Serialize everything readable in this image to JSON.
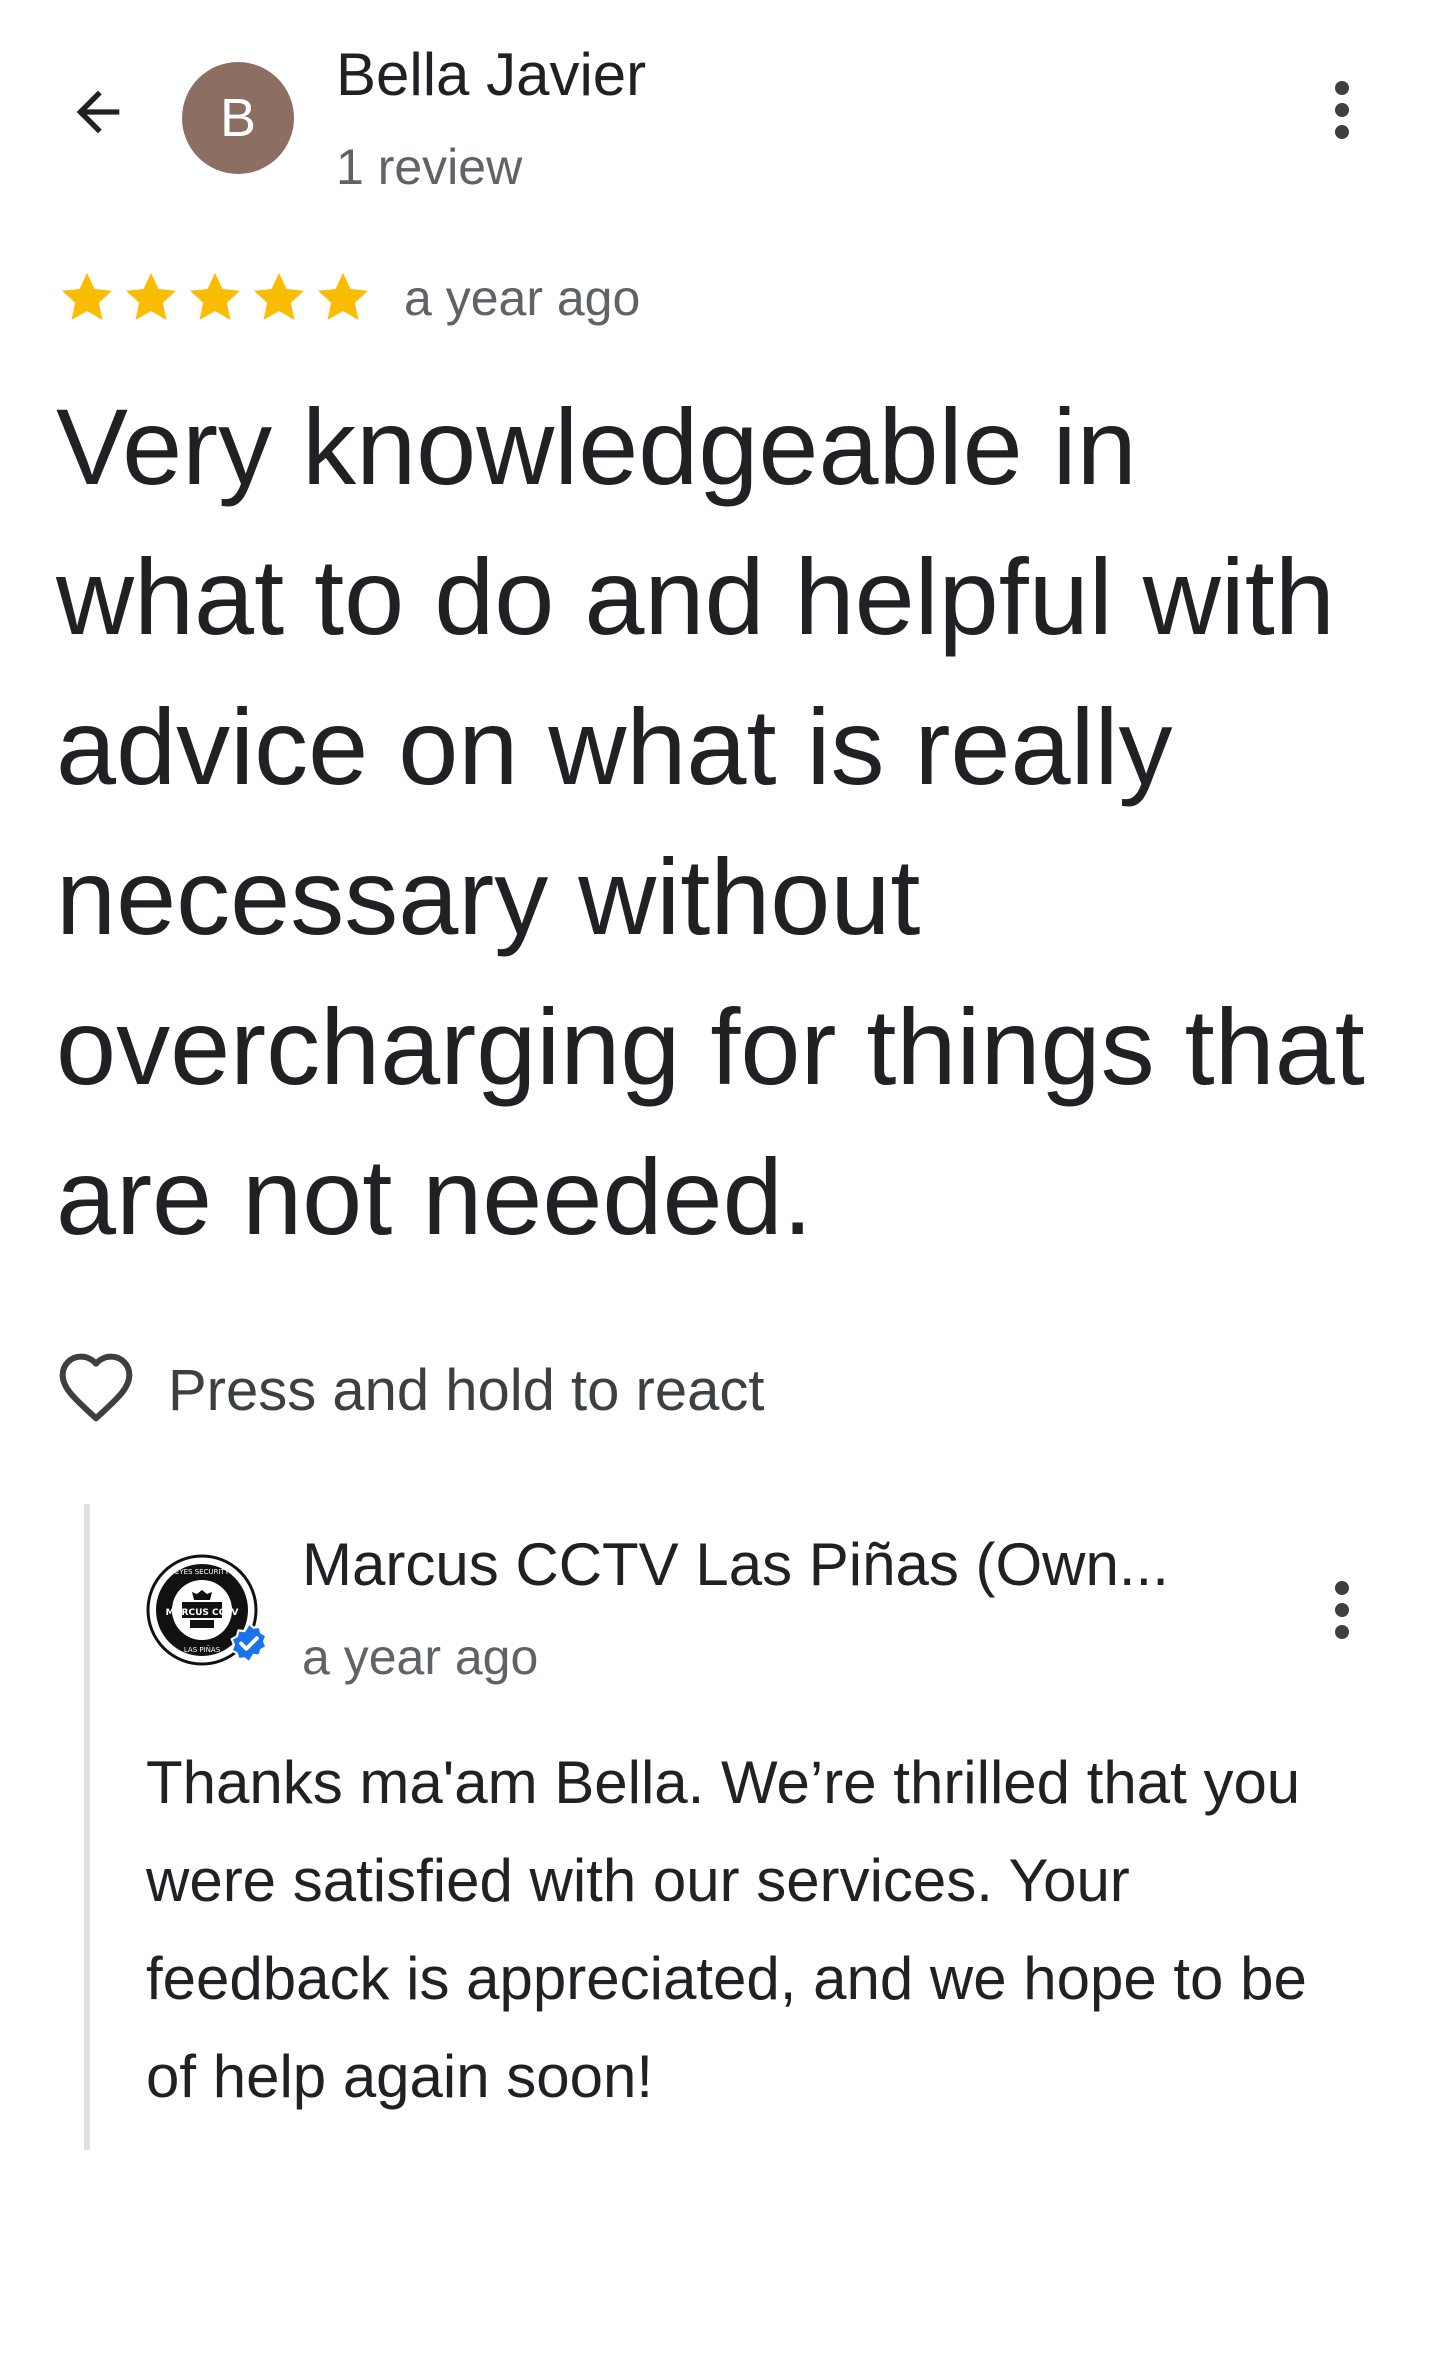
{
  "colors": {
    "avatar_bg": "#8d6e63",
    "star": "#fbbc04",
    "verified": "#1a73e8",
    "text_primary": "#202124",
    "text_secondary": "#5f6368"
  },
  "header": {
    "back_icon": "arrow-back-icon",
    "avatar_letter": "B",
    "author_name": "Bella Javier",
    "author_meta": "1 review",
    "more_icon": "more-vert-icon"
  },
  "review": {
    "rating": 5,
    "rating_max": 5,
    "time": "a year ago",
    "text": "Very knowledgeable in what to do and helpful with advice on what is really necessary without overcharging for things that are not needed."
  },
  "react": {
    "icon": "heart-outline-icon",
    "label": "Press and hold to react"
  },
  "owner_reply": {
    "logo_text_top": "EYES SECURITY",
    "logo_text_brand": "MARCUS CCTV",
    "logo_text_bottom": "LAS PIÑAS",
    "verified_icon": "verified-check-icon",
    "name": "Marcus CCTV Las Piñas (Own...",
    "time": "a year ago",
    "text": "Thanks ma'am Bella. We’re thrilled that you were satisfied with our services. Your feedback is appreciated, and we hope to be of help again soon!"
  }
}
